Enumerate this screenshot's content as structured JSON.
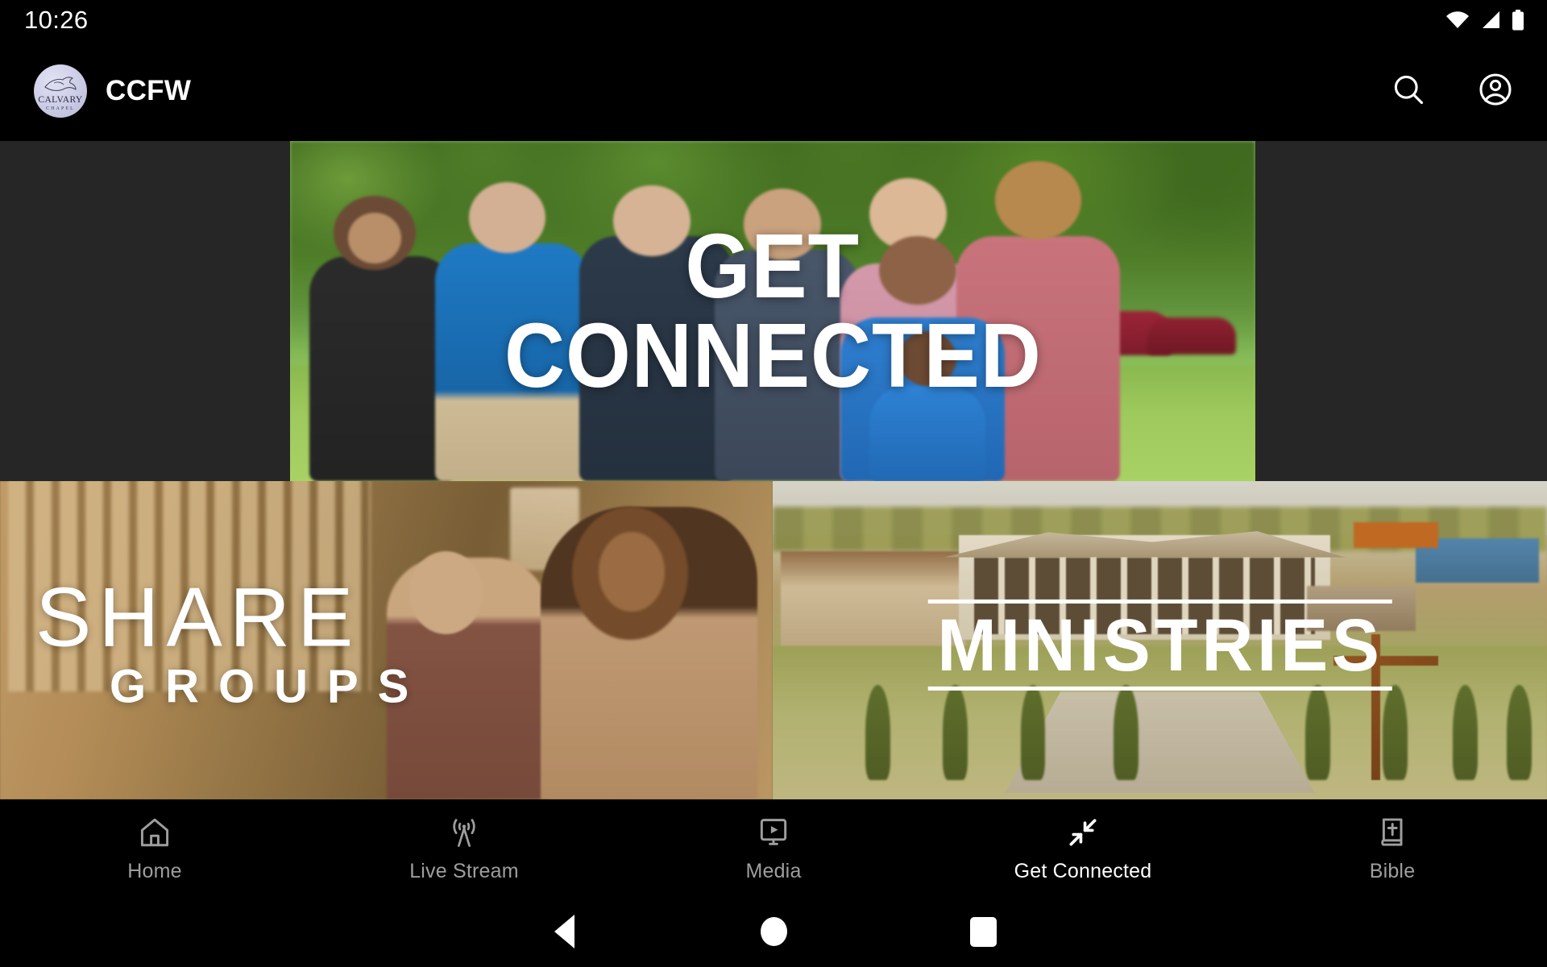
{
  "status_bar": {
    "time": "10:26",
    "icons": [
      "wifi-icon",
      "cellular-signal-icon",
      "battery-icon"
    ]
  },
  "app_bar": {
    "logo": {
      "name": "calvary-chapel-logo",
      "word_top": "CALVARY",
      "word_bottom": "CHAPEL",
      "background_color": "#c9cae5"
    },
    "title": "CCFW",
    "actions": [
      {
        "name": "search-icon",
        "label": "Search"
      },
      {
        "name": "account-circle-icon",
        "label": "Account"
      }
    ]
  },
  "content": {
    "background_color": "#262626",
    "hero": {
      "name": "get-connected-hero-banner",
      "caption_line1": "GET",
      "caption_line2": "CONNECTED",
      "caption_color": "#ffffff",
      "image_description": "Group of smiling people outdoors on a sunny lawn at a church event"
    },
    "cards": [
      {
        "name": "share-groups-card",
        "title": "SHARE",
        "subtitle": "GROUPS",
        "caption_color": "#ffffff",
        "image_description": "Young adults talking together in a warmly lit living room"
      },
      {
        "name": "ministries-card",
        "title": "MINISTRIES",
        "caption_color": "#ffffff",
        "image_description": "Aerial view of the church campus building with a large wooden cross"
      }
    ]
  },
  "bottom_nav": {
    "active_index": 3,
    "active_color": "#ffffff",
    "inactive_color": "#9e9e9e",
    "items": [
      {
        "label": "Home",
        "icon": "home-icon"
      },
      {
        "label": "Live Stream",
        "icon": "broadcast-tower-icon"
      },
      {
        "label": "Media",
        "icon": "media-play-monitor-icon"
      },
      {
        "label": "Get Connected",
        "icon": "connect-arrows-icon"
      },
      {
        "label": "Bible",
        "icon": "bible-book-icon"
      }
    ]
  },
  "android_nav": {
    "items": [
      {
        "label": "Back",
        "icon": "back-triangle-icon"
      },
      {
        "label": "Home",
        "icon": "home-circle-icon"
      },
      {
        "label": "Recents",
        "icon": "recents-square-icon"
      }
    ]
  }
}
